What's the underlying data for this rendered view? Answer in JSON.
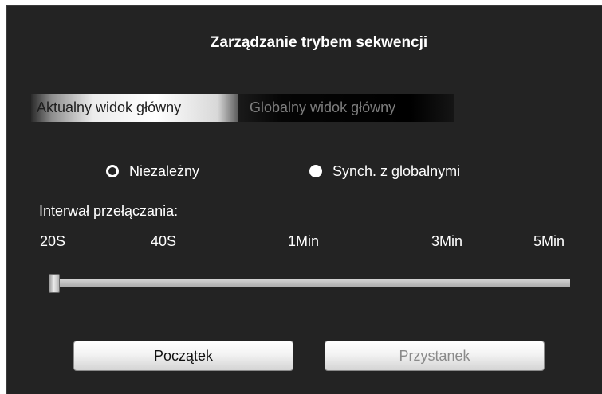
{
  "dialog": {
    "title": "Zarządzanie trybem sekwencji"
  },
  "tabs": [
    {
      "label": "Aktualny widok główny",
      "active": true
    },
    {
      "label": "Globalny widok główny",
      "active": false
    }
  ],
  "mode": {
    "options": [
      {
        "label": "Niezależny",
        "selected": false
      },
      {
        "label": "Synch. z globalnymi",
        "selected": true
      }
    ]
  },
  "interval": {
    "label": "Interwał przełączania:",
    "ticks": [
      "20S",
      "40S",
      "1Min",
      "3Min",
      "5Min"
    ],
    "selected_fraction": 0
  },
  "buttons": {
    "start_label": "Początek",
    "stop_label": "Przystanek",
    "stop_enabled": false
  },
  "colors": {
    "background": "#232323",
    "text": "#ffffff",
    "disabled_text": "#8a8a8a"
  }
}
